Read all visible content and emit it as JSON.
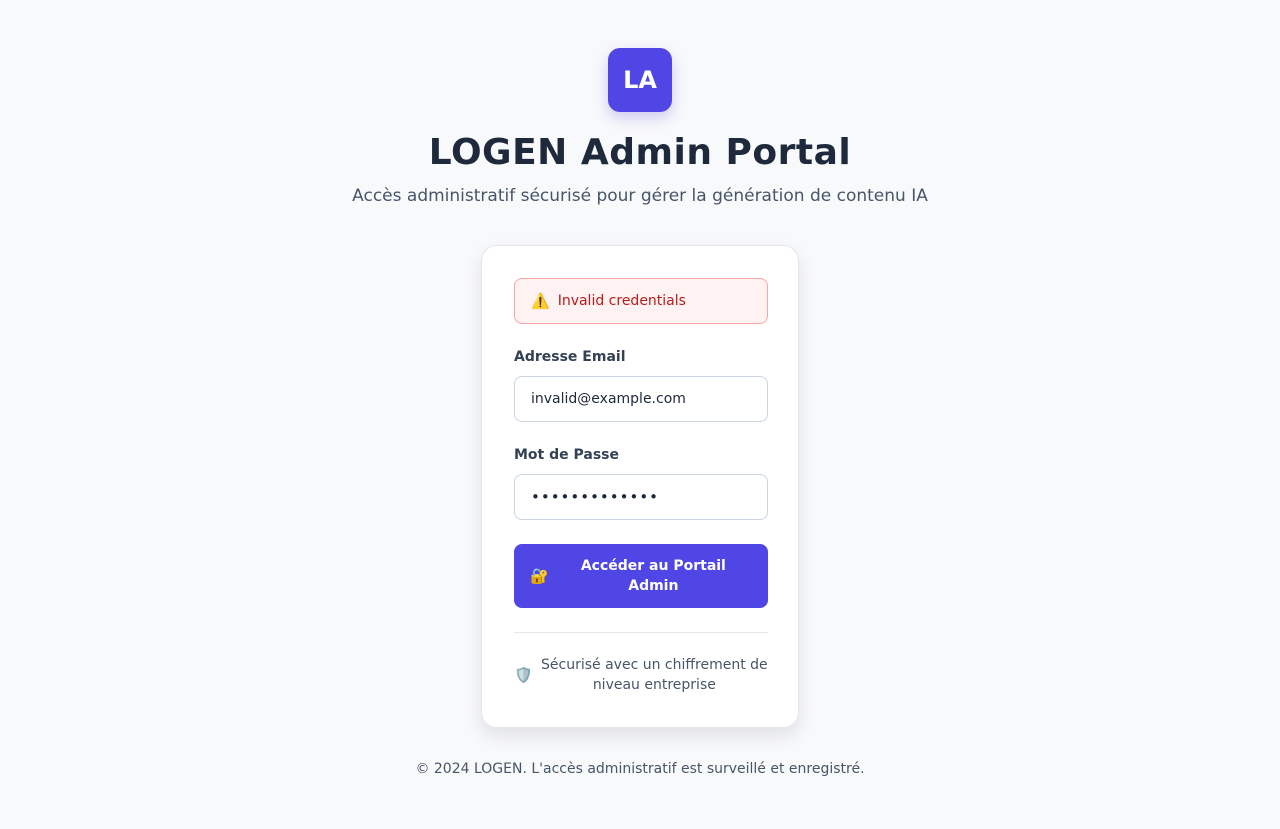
{
  "brand": {
    "logo_text": "LA",
    "title": "LOGEN Admin Portal",
    "subtitle": "Accès administratif sécurisé pour gérer la génération de contenu IA"
  },
  "alert": {
    "icon": "warning-icon",
    "icon_glyph": "⚠️",
    "message": "Invalid credentials",
    "color": "#b91c1c"
  },
  "form": {
    "email_label": "Adresse Email",
    "email_value": "invalid@example.com",
    "password_label": "Mot de Passe",
    "password_value": "•••••••••••••",
    "submit_icon": "lock-icon",
    "submit_icon_glyph": "🔐",
    "submit_label": "Accéder au Portail Admin"
  },
  "security_note": {
    "icon": "shield-icon",
    "icon_glyph": "🛡️",
    "text": "Sécurisé avec un chiffrement de niveau entreprise"
  },
  "footer": {
    "text": "© 2024 LOGEN. L'accès administratif est surveillé et enregistré."
  },
  "colors": {
    "accent": "#4f46e5",
    "background": "#f8f9fb",
    "error_bg": "#fef2f2",
    "error_border": "#fca5a5"
  }
}
